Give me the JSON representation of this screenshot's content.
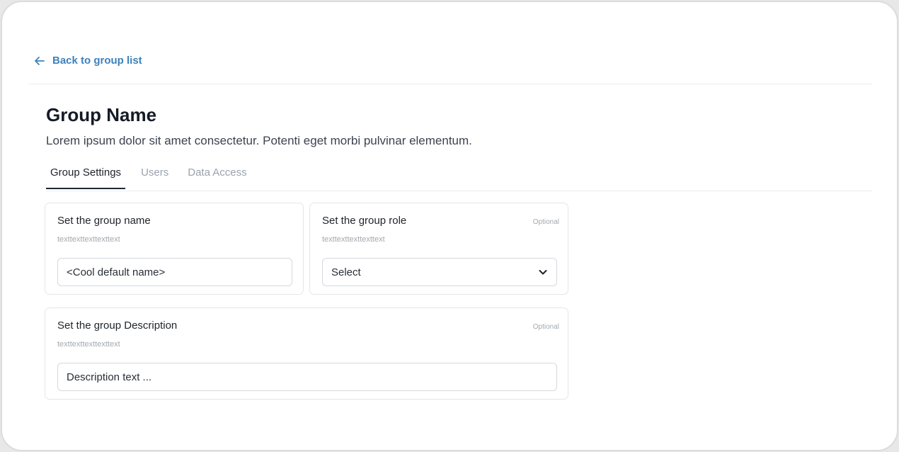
{
  "nav": {
    "back_label": "Back to group list"
  },
  "header": {
    "title": "Group Name",
    "subtitle": "Lorem ipsum dolor sit amet consectetur. Potenti eget morbi pulvinar elementum."
  },
  "tabs": [
    {
      "label": "Group Settings",
      "active": true
    },
    {
      "label": "Users",
      "active": false
    },
    {
      "label": "Data Access",
      "active": false
    }
  ],
  "form": {
    "group_name": {
      "title": "Set the group name",
      "hint": "texttexttexttexttext",
      "placeholder": "<Cool default name>"
    },
    "group_role": {
      "title": "Set the group role",
      "hint": "texttexttexttexttext",
      "optional_label": "Optional",
      "selected": "Select"
    },
    "group_description": {
      "title": "Set the group Description",
      "hint": "texttexttexttexttext",
      "optional_label": "Optional",
      "placeholder": "Description text ..."
    }
  },
  "icons": {
    "back": "arrow-left-icon",
    "dropdown": "chevron-down-icon"
  },
  "colors": {
    "link": "#3c82bd",
    "muted_text": "#9aa3ae",
    "border": "#e6e6e6"
  }
}
